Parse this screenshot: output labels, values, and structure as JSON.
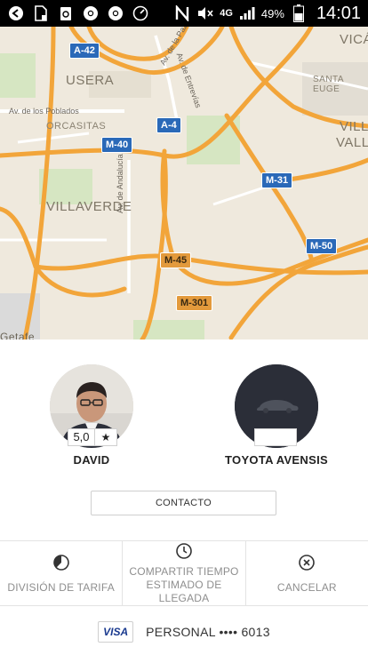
{
  "status_bar": {
    "network": "4G",
    "battery": "49%",
    "time": "14:01",
    "icons": [
      "back-icon",
      "file-icon",
      "recycle-icon",
      "chrome-icon",
      "chrome-icon",
      "speed-icon",
      "nfc-icon",
      "mute-icon",
      "signal-icon",
      "battery-icon"
    ]
  },
  "map": {
    "roads": [
      "A-42",
      "A-4",
      "M-40",
      "M-31",
      "M-45",
      "M-50",
      "M-301"
    ],
    "places": [
      "USERA",
      "ORCASITAS",
      "VILLAVERDE",
      "VICÁ",
      "SANTA EUGE",
      "VILLA",
      "VALLE",
      "Getafe"
    ],
    "streets": [
      "Av. de los Poblados",
      "Av. de Andalucía",
      "Av. de la Paz",
      "Av. de Entrevías"
    ]
  },
  "driver": {
    "name": "DAVID",
    "rating": "5,0",
    "rating_icon": "star-icon"
  },
  "vehicle": {
    "name": "TOYOTA AVENSIS"
  },
  "contact_label": "CONTACTO",
  "actions": {
    "split": "DIVISIÓN DE TARIFA",
    "share_line1": "COMPARTIR TIEMPO",
    "share_line2": "ESTIMADO DE LLEGADA",
    "cancel": "CANCELAR"
  },
  "payment": {
    "card_brand": "VISA",
    "label": "PERSONAL •••• 6013"
  },
  "colors": {
    "road": "#f2a53a",
    "map_bg": "#efe9dd",
    "park": "#cfe3b9",
    "shield_blue": "#2a69b8",
    "shield_orange": "#e39a3c"
  }
}
